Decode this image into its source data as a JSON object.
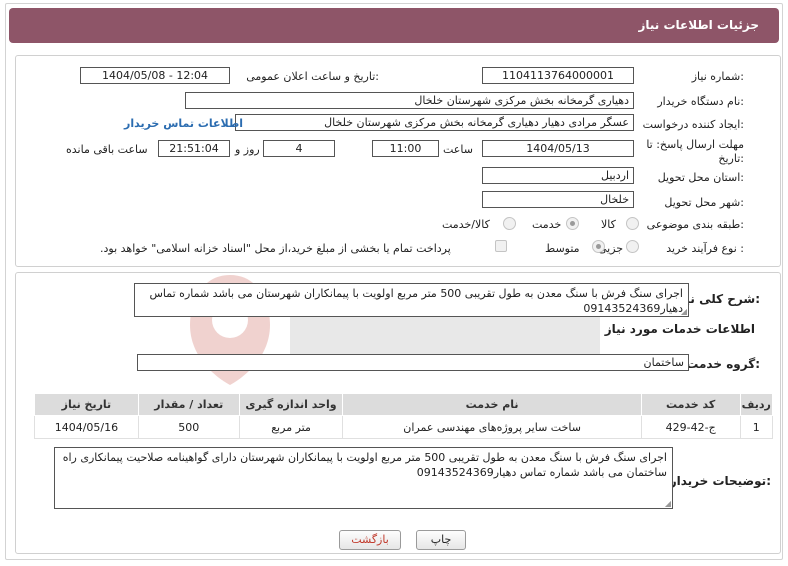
{
  "header": {
    "title": "جزئیات اطلاعات نیاز"
  },
  "fields": {
    "need_number": {
      "label": "شماره نیاز:",
      "value": "1104113764000001"
    },
    "announce_datetime": {
      "label": "تاریخ و ساعت اعلان عمومی:",
      "value": "1404/05/08 - 12:04"
    },
    "buyer_org": {
      "label": "نام دستگاه خریدار:",
      "value": "دهیاری گرمخانه بخش مرکزی شهرستان خلخال"
    },
    "requester": {
      "label": "ایجاد کننده درخواست:",
      "value": "عسگر مرادی دهیار دهیاری گرمخانه بخش مرکزی شهرستان خلخال"
    },
    "buyer_contact_link": "اطلاعات تماس خریدار",
    "deadline": {
      "label_line1": "مهلت ارسال پاسخ: تا",
      "label_line2": "تاریخ:",
      "date": "1404/05/13",
      "time_label": "ساعت",
      "time": "11:00",
      "days": "4",
      "days_label": "روز و",
      "remaining": "21:51:04",
      "remaining_label": "ساعت باقی مانده"
    },
    "province": {
      "label": "استان محل تحویل:",
      "value": "اردبیل"
    },
    "city": {
      "label": "شهر محل تحویل:",
      "value": "خلخال"
    },
    "category": {
      "label": "طبقه بندی موضوعی:",
      "options": [
        "کالا",
        "خدمت",
        "کالا/خدمت"
      ],
      "selected": "خدمت"
    },
    "purchase_process": {
      "label": "نوع فرآیند خرید :",
      "options": [
        "جزیی",
        "متوسط"
      ],
      "selected": "متوسط",
      "payment_note": "پرداخت تمام یا بخشی از مبلغ خرید،از محل \"اسناد خزانه اسلامی\" خواهد بود."
    }
  },
  "summary": {
    "label": "شرح کلی نیاز:",
    "text": "اجرای سنگ فرش با سنگ معدن به طول تقریبی 500 متر مربع  اولویت با پیمانکاران شهرستان  می باشد شماره تماس دهیار09143524369"
  },
  "services": {
    "title": "اطلاعات خدمات مورد نیاز",
    "group_label": "گروه خدمت:",
    "group_value": "ساختمان",
    "columns": [
      "ردیف",
      "کد خدمت",
      "نام خدمت",
      "واحد اندازه گیری",
      "تعداد / مقدار",
      "تاریخ نیاز"
    ],
    "rows": [
      [
        "1",
        "ج-42-429",
        "ساخت سایر پروژه‌های مهندسی عمران",
        "متر مربع",
        "500",
        "1404/05/16"
      ]
    ]
  },
  "buyer_notes": {
    "label": "توضیحات خریدار:",
    "text": "اجرای سنگ فرش با سنگ معدن به طول تقریبی 500 متر مربع  اولویت با پیمانکاران شهرستان دارای گواهینامه صلاحیت پیمانکاری راه ساختمان می باشد شماره تماس دهیار09143524369"
  },
  "buttons": {
    "print": "چاپ",
    "back": "بازگشت"
  },
  "colors": {
    "header_bg": "#8e5568",
    "link": "#2b6cb0",
    "back_button_text": "#c0392b"
  }
}
